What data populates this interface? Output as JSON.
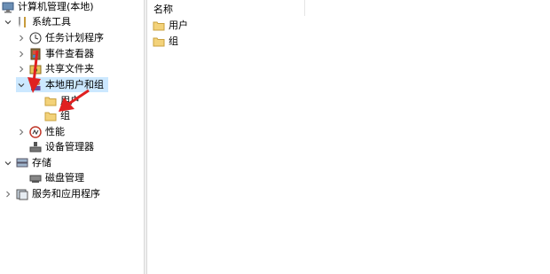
{
  "tree": {
    "root": "计算机管理(本地)",
    "system_tools": "系统工具",
    "task_scheduler": "任务计划程序",
    "event_viewer": "事件查看器",
    "shared_folders": "共享文件夹",
    "local_users": "本地用户和组",
    "users": "用户",
    "groups": "组",
    "performance": "性能",
    "device_manager": "设备管理器",
    "storage": "存储",
    "disk_mgmt": "磁盘管理",
    "services": "服务和应用程序"
  },
  "list": {
    "column_name": "名称",
    "items": [
      "用户",
      "组"
    ]
  },
  "colors": {
    "selection": "#cce8ff",
    "arrow": "#e02020",
    "folder": "#f3d27a"
  },
  "icons": {
    "root": "computer-management-icon",
    "system_tools": "tools-icon",
    "task_scheduler": "clock-icon",
    "event_viewer": "event-viewer-icon",
    "shared_folders": "shared-folder-icon",
    "local_users": "users-group-icon",
    "folder": "folder-icon",
    "performance": "performance-icon",
    "device_manager": "device-manager-icon",
    "storage": "storage-icon",
    "disk_mgmt": "disk-icon",
    "services": "services-icon"
  }
}
